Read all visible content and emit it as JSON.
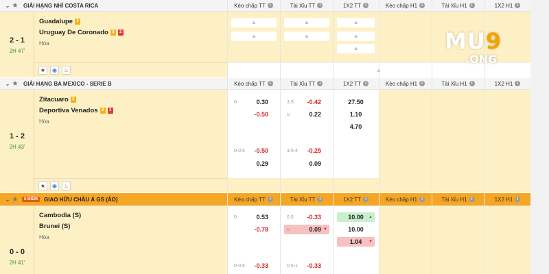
{
  "columns": [
    "Kèo chấp TT",
    "Tài Xỉu TT",
    "1X2 TT",
    "Kèo chấp H1",
    "Tài Xỉu H1",
    "1X2 H1"
  ],
  "logo": {
    "main_a": "MU",
    "main_b": "9",
    "sub": ".ONG"
  },
  "league1": {
    "name": "GIẢI HẠNG NHÌ COSTA RICA",
    "score": "2 - 1",
    "time": "2H 47'",
    "home": "Guadalupe",
    "home_badge": "3",
    "away": "Uruguay De Coronado",
    "away_badge1": "3",
    "away_badge2": "2",
    "draw": "Hòa"
  },
  "league2": {
    "name": "GIẢI HẠNG BA MEXICO - SERIE B",
    "score": "1 - 2",
    "time": "2H 43'",
    "home": "Zitacuaro",
    "home_badge": "2",
    "away": "Deportiva Venados",
    "away_badge1": "3",
    "away_badge2": "1",
    "draw": "Hòa",
    "r1": {
      "hdp_h": "0",
      "hdp_v": "0.30",
      "hdp2_v": "-0.50",
      "ou_h": "3.5",
      "ou_v": "-0.42",
      "ou2_h": "u",
      "ou2_v": "0.22",
      "x1": "27.50",
      "x2": "1.10",
      "x3": "4.70"
    },
    "r2": {
      "hdp_h": "0-0.5",
      "hdp_v": "-0.50",
      "hdp2_v": "0.29",
      "ou_h": "3.5-4",
      "ou_v": "-0.25",
      "ou2_v": "0.09"
    }
  },
  "league3": {
    "promo": "5 ĐIỂM",
    "name": "GIAO HỮU CHÂU Á GS (ẢO)",
    "score": "0 - 0",
    "time": "2H 41'",
    "home": "Cambodia (S)",
    "away": "Brunei (S)",
    "draw": "Hòa",
    "r1": {
      "hdp_h": "0",
      "hdp_v": "0.53",
      "hdp2_v": "-0.78",
      "ou_h": "0.5",
      "ou_v": "-0.33",
      "ou2_h": "u",
      "ou2_v": "0.09",
      "x1": "10.00",
      "x2": "10.00",
      "x3": "1.04"
    },
    "r2": {
      "hdp_h": "0-0.5",
      "hdp_v": "-0.33",
      "ou_h": "0.5-1",
      "ou_v": "-0.33"
    }
  }
}
